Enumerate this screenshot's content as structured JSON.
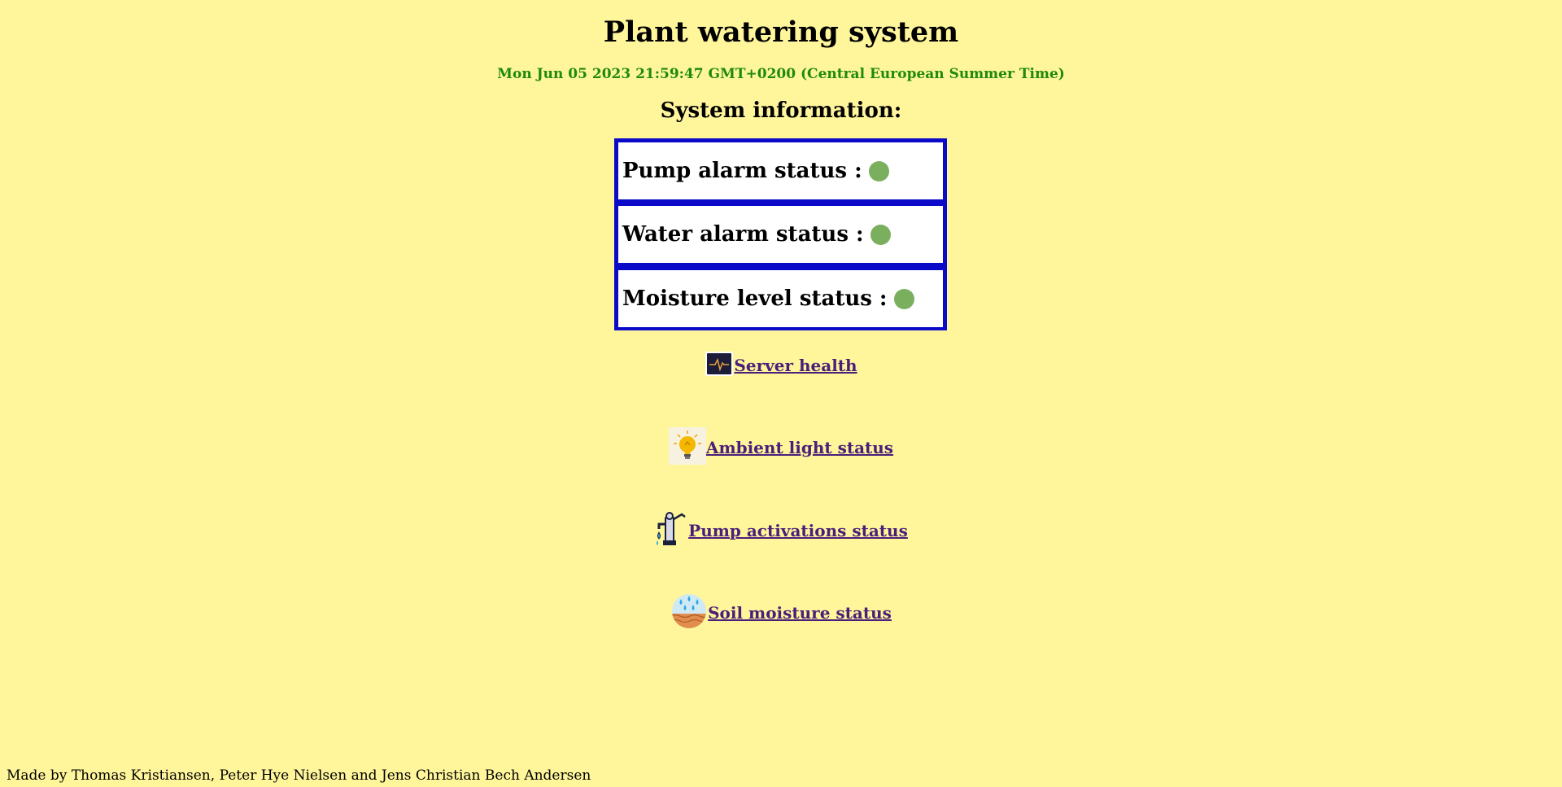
{
  "header": {
    "title": "Plant watering system",
    "datetime": "Mon Jun 05 2023 21:59:47 GMT+0200 (Central European Summer Time)",
    "datetime_color": "#1e8a0e"
  },
  "system_info": {
    "title": "System information:",
    "items": [
      {
        "label": "Pump alarm status :",
        "status_color": "#7aaf5e"
      },
      {
        "label": "Water alarm status :",
        "status_color": "#7aaf5e"
      },
      {
        "label": "Moisture level status :",
        "status_color": "#7aaf5e"
      }
    ]
  },
  "links": [
    {
      "label": "Server health",
      "icon": "pulse-monitor-icon"
    },
    {
      "label": "Ambient light status",
      "icon": "light-bulb-icon"
    },
    {
      "label": "Pump activations status",
      "icon": "water-pump-icon"
    },
    {
      "label": "Soil moisture status",
      "icon": "soil-moisture-icon"
    }
  ],
  "footer": {
    "credits": "Made by Thomas Kristiansen, Peter Hye Nielsen and Jens Christian Bech Andersen"
  },
  "colors": {
    "background": "#fff59b",
    "table_border": "#0a0ac8",
    "link": "#4a1f7a"
  }
}
